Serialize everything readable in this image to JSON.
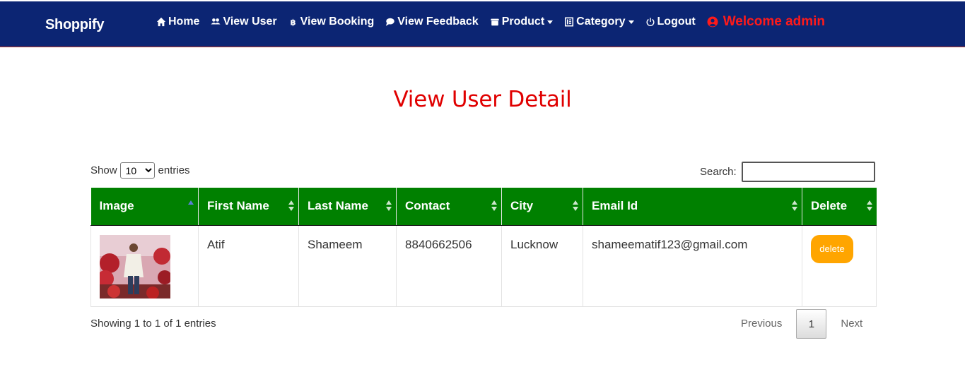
{
  "brand": "Shoppify",
  "nav": {
    "home": "Home",
    "view_user": "View User",
    "view_booking": "View Booking",
    "view_feedback": "View Feedback",
    "product": "Product",
    "category": "Category",
    "logout": "Logout",
    "welcome": "Welcome admin"
  },
  "page_title": "View User Detail",
  "length_control": {
    "show_label": "Show",
    "selected": "10",
    "entries_label": "entries"
  },
  "search": {
    "label": "Search:",
    "value": ""
  },
  "table": {
    "headers": [
      "Image",
      "First Name",
      "Last Name",
      "Contact",
      "City",
      "Email Id",
      "Delete"
    ],
    "rows": [
      {
        "first_name": "Atif",
        "last_name": "Shameem",
        "contact": "8840662506",
        "city": "Lucknow",
        "email": "shameematif123@gmail.com",
        "delete_label": "delete"
      }
    ]
  },
  "footer": {
    "info": "Showing 1 to 1 of 1 entries",
    "previous": "Previous",
    "page": "1",
    "next": "Next"
  },
  "colors": {
    "navbar": "#0c2573",
    "title": "#e00000",
    "table_header": "#008000",
    "delete_button": "#ffa500",
    "welcome": "#ff1a1a"
  }
}
